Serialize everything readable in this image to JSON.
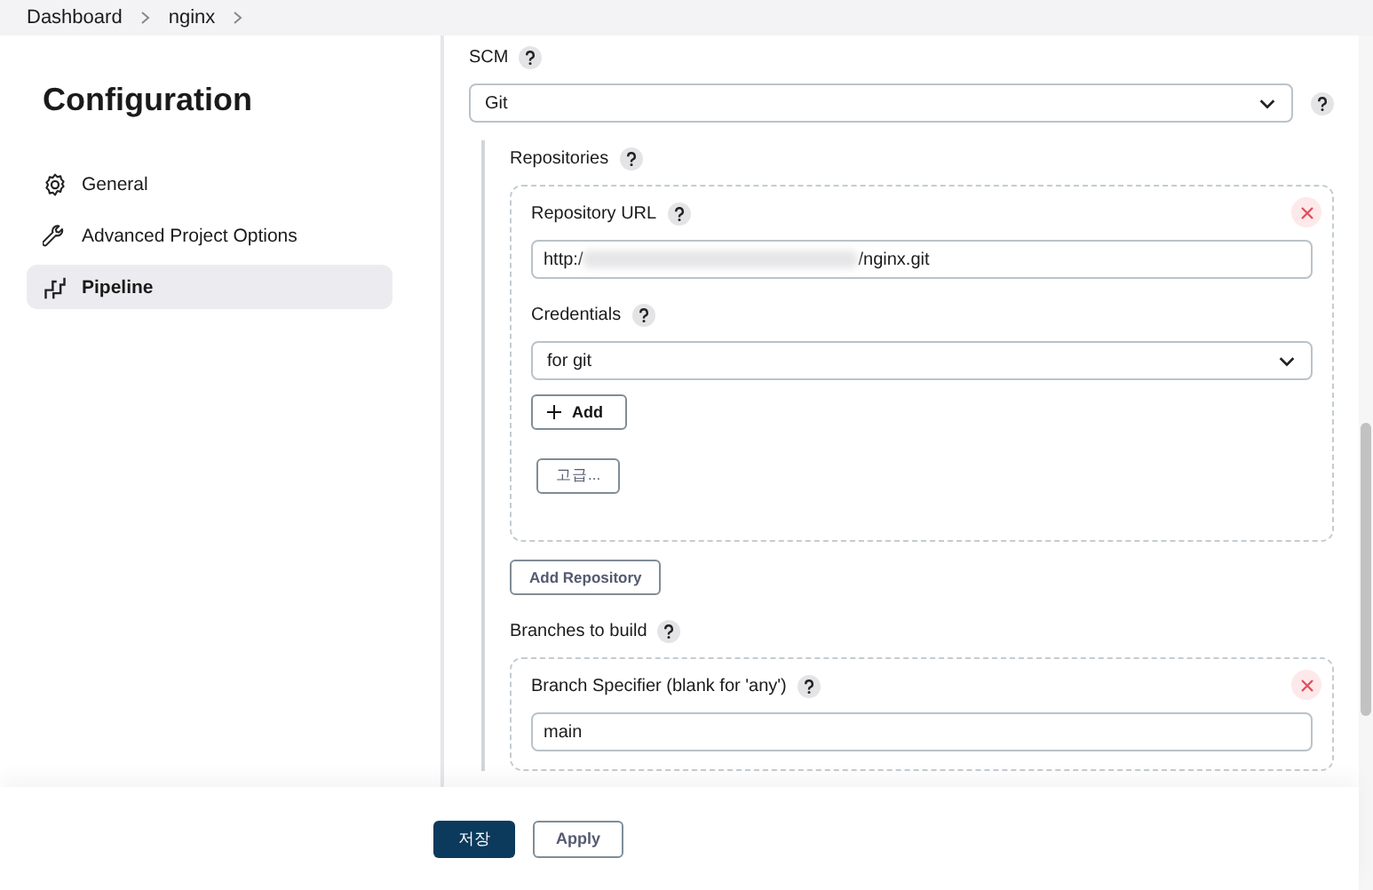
{
  "breadcrumb": [
    "Dashboard",
    "nginx"
  ],
  "sidebar": {
    "title": "Configuration",
    "items": [
      {
        "label": "General",
        "selected": false
      },
      {
        "label": "Advanced Project Options",
        "selected": false
      },
      {
        "label": "Pipeline",
        "selected": true
      }
    ]
  },
  "scm": {
    "label": "SCM",
    "value": "Git"
  },
  "repositories": {
    "label": "Repositories",
    "url_label": "Repository URL",
    "url_start": "http:/",
    "url_end": "/nginx.git",
    "credentials_label": "Credentials",
    "credentials_value": "for git",
    "add_button": "Add",
    "advanced_button": "고급...",
    "add_repository_button": "Add Repository"
  },
  "branches": {
    "label": "Branches to build",
    "specifier_label": "Branch Specifier (blank for 'any')",
    "specifier_value": "main"
  },
  "footer": {
    "save_button": "저장",
    "apply_button": "Apply"
  }
}
